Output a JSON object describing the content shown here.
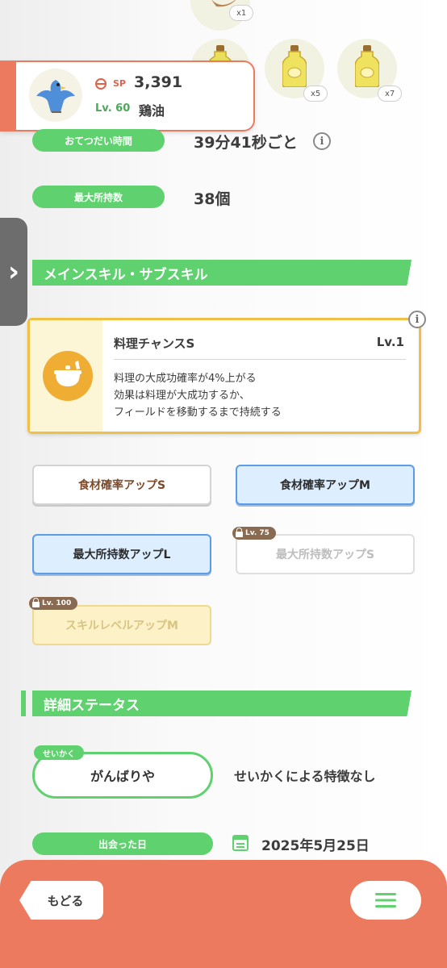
{
  "ingredients": [
    {
      "icon": "meat-icon",
      "count": "x1"
    },
    {
      "icon": "oil-bottle-icon",
      "count": "x5"
    },
    {
      "icon": "oil-bottle-icon",
      "count": "x7"
    }
  ],
  "pokemon": {
    "sp_label": "SP",
    "sp_value": "3,391",
    "level": "Lv. 60",
    "name": "鶏油"
  },
  "stats": {
    "help_time_label": "おてつだい時間",
    "help_time_value": "39分41秒ごと",
    "max_carry_label": "最大所持数",
    "max_carry_value": "38個"
  },
  "skills_section": {
    "title": "メインスキル・サブスキル"
  },
  "main_skill": {
    "name": "料理チャンスS",
    "level": "Lv.1",
    "desc_line1": "料理の大成功確率が4%上がる",
    "desc_line2": "効果は料理が大成功するか、",
    "desc_line3": "フィールドを移動するまで持続する",
    "icon": "cooking-pot-icon"
  },
  "sub_skills": [
    {
      "label": "食材確率アップS",
      "style": "white"
    },
    {
      "label": "食材確率アップM",
      "style": "blue"
    },
    {
      "label": "最大所持数アップL",
      "style": "blue"
    },
    {
      "label": "最大所持数アップS",
      "style": "disabled",
      "lock": "Lv. 75"
    },
    {
      "label": "スキルレベルアップM",
      "style": "gold",
      "lock": "Lv. 100"
    }
  ],
  "details_section": {
    "title": "詳細ステータス"
  },
  "nature": {
    "tag": "せいかく",
    "value": "がんばりや",
    "effect": "せいかくによる特徴なし"
  },
  "met_date": {
    "label": "出会った日",
    "value": "2025年5月25日"
  },
  "bottom": {
    "back_label": "もどる"
  },
  "colors": {
    "accent_green": "#5fd16e",
    "bottom_bar": "#ec7a5f",
    "skill_gold": "#efbf46"
  }
}
